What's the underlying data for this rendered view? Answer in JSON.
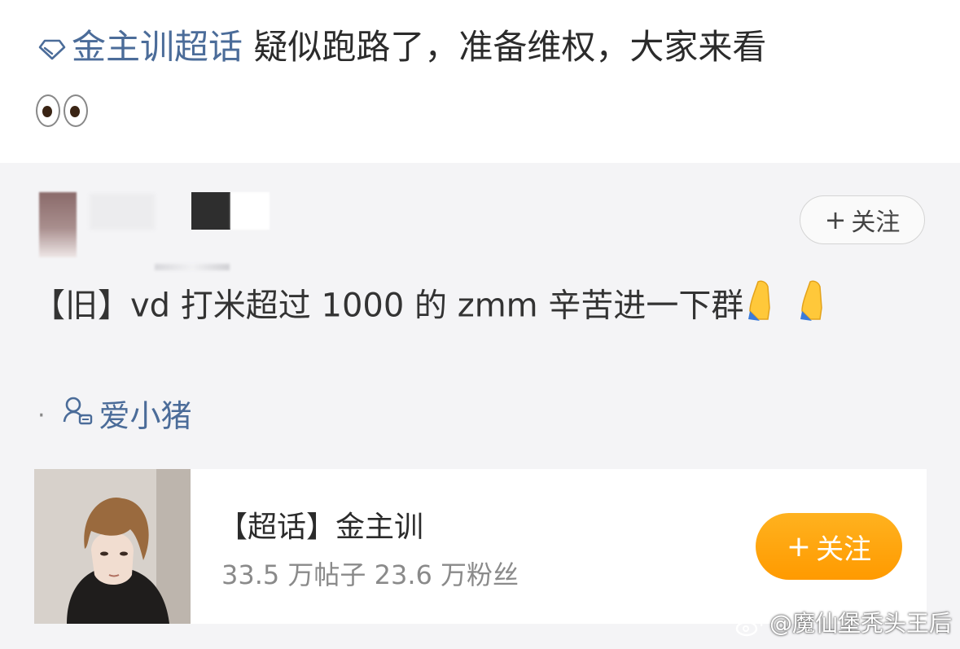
{
  "post": {
    "topic_link": "金主训超话",
    "title_text": " 疑似跑路了，准备维权，大家来看",
    "emoji": "eyes-emoji"
  },
  "repost": {
    "follow_label": "关注",
    "follow_icon": "plus-icon",
    "body": "【旧】vd 打米超过 1000 的 zmm 辛苦进一下群",
    "emoji": "folded-hands-emoji",
    "location_name": "爱小猪",
    "location_icon": "location-person-icon"
  },
  "supertopic_card": {
    "name": "【超话】金主训",
    "stats": "33.5 万帖子 23.6 万粉丝",
    "follow_label": "关注",
    "accent": "#ff9a00"
  },
  "watermark": {
    "text": "@魔仙堡秃头王后",
    "icon": "weibo-logo-icon"
  },
  "colors": {
    "link": "#4b6c99",
    "card_bg": "#f4f4f6"
  }
}
